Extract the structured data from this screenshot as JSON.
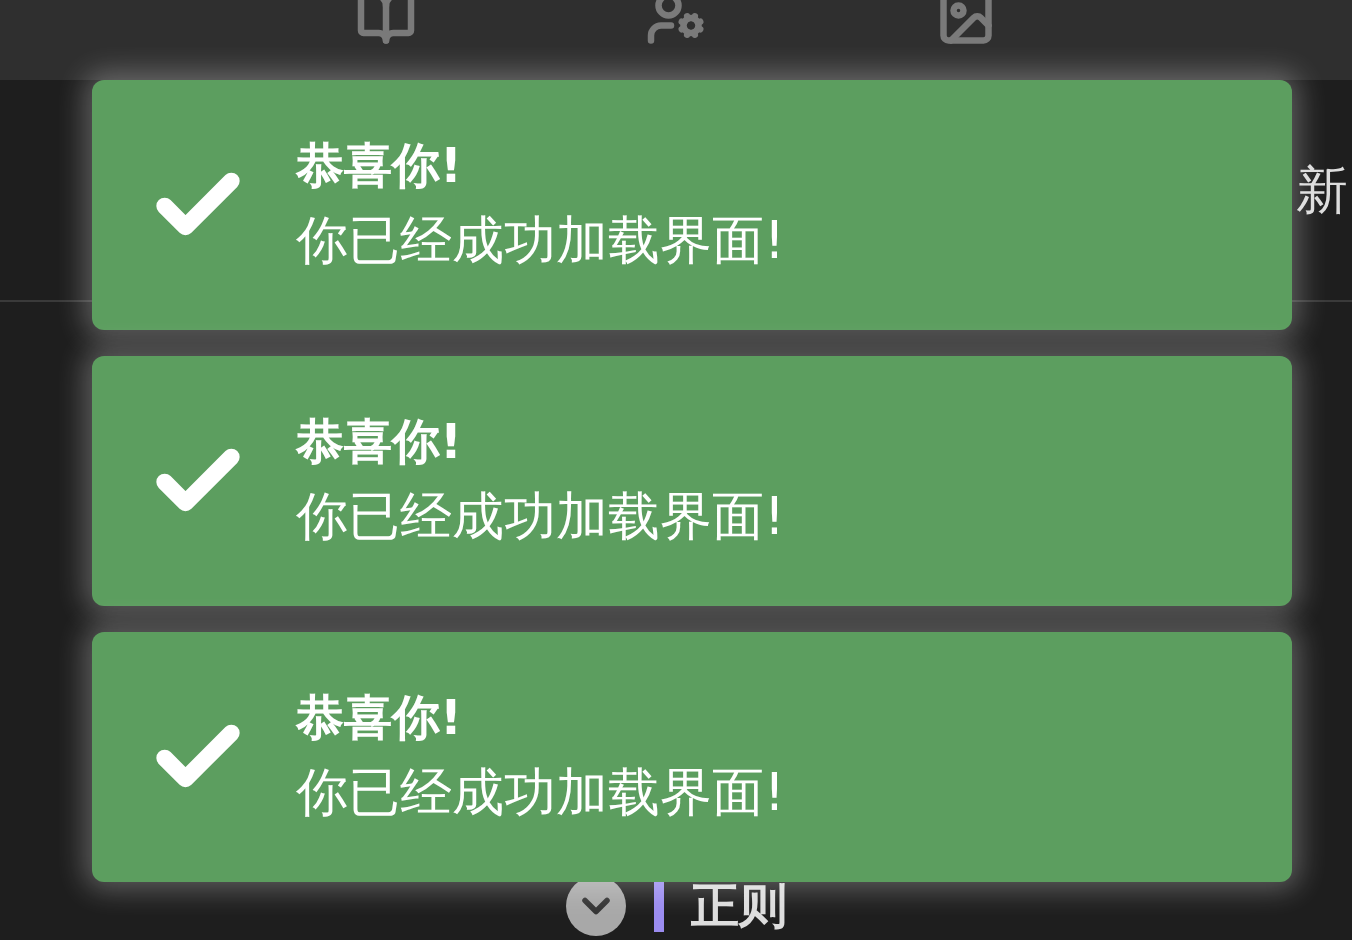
{
  "header_row": {
    "text": "新"
  },
  "footer_row": {
    "label": "正则"
  },
  "toasts": [
    {
      "kind": "success",
      "title": "恭喜你!",
      "message": "你已经成功加载界面!"
    },
    {
      "kind": "success",
      "title": "恭喜你!",
      "message": "你已经成功加载界面!"
    },
    {
      "kind": "success",
      "title": "恭喜你!",
      "message": "你已经成功加载界面!"
    }
  ]
}
